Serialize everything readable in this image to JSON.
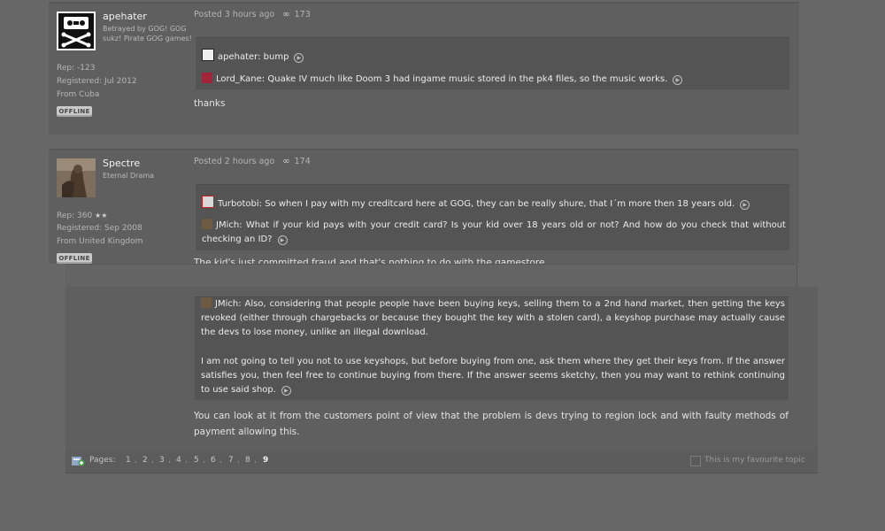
{
  "posts": [
    {
      "username": "apehater",
      "user_title": "Betrayed by GOG! GOG sukz! Pirate GOG games!",
      "rep": "Rep: -123",
      "registered": "Registered: Jul 2012",
      "from": "From Cuba",
      "status": "OFFLINE",
      "posted": "Posted 3 hours ago",
      "post_number": "173",
      "quotes": [
        {
          "author": "apehater",
          "text": "bump"
        },
        {
          "author": "Lord_Kane",
          "text": "Quake IV much like Doom 3 had ingame music stored in the pk4 files, so the music works."
        }
      ],
      "body": "thanks"
    },
    {
      "username": "Spectre",
      "user_title": "Eternal Drama",
      "rep": "Rep: 360",
      "rep_stars": "★★",
      "registered": "Registered: Sep 2008",
      "from": "From United Kingdom",
      "status": "OFFLINE",
      "posted": "Posted 2 hours ago",
      "post_number": "174",
      "quotes": [
        {
          "author": "Turbotobi",
          "text": "So when I pay with my creditcard here at GOG, they can be really shure, that I´m more then 18 years old."
        },
        {
          "author": "JMich",
          "text": "What if your kid pays with your credit card? Is your kid over 18 years old or not? And how do you check that without checking an ID?"
        }
      ],
      "body_clipped": "The kid's just committed fraud and that's nothing to do with the gamestore"
    }
  ],
  "continued": {
    "quote_author": "JMich",
    "quote_para1": "Also, considering that people people have been buying keys, selling them to a 2nd hand market, then getting the keys revoked (either through chargebacks or because they bought the key with a stolen card), a keyshop purchase may actually cause the devs to lose money, unlike an illegal download.",
    "quote_para2": "I am not going to tell you not to use keyshops, but before buying from one, ask them where they get their keys from. If the answer satisfies you, then feel free to continue buying from there. If the answer seems sketchy, then you may want to rethink continuing to use said shop.",
    "body": "You can look at it from the customers point of view that the problem is devs trying to region lock and with faulty methods of payment allowing this."
  },
  "footer": {
    "pages_label": "Pages:",
    "pages": [
      "1",
      "2",
      "3",
      "4",
      "5",
      "6",
      "7",
      "8",
      "9"
    ],
    "current_page": "9",
    "favourite_label": "This is my favourite topic"
  },
  "icons": {
    "jump": "arrow-circle-icon",
    "views": "glasses-icon",
    "footer": "new-topic-icon"
  }
}
